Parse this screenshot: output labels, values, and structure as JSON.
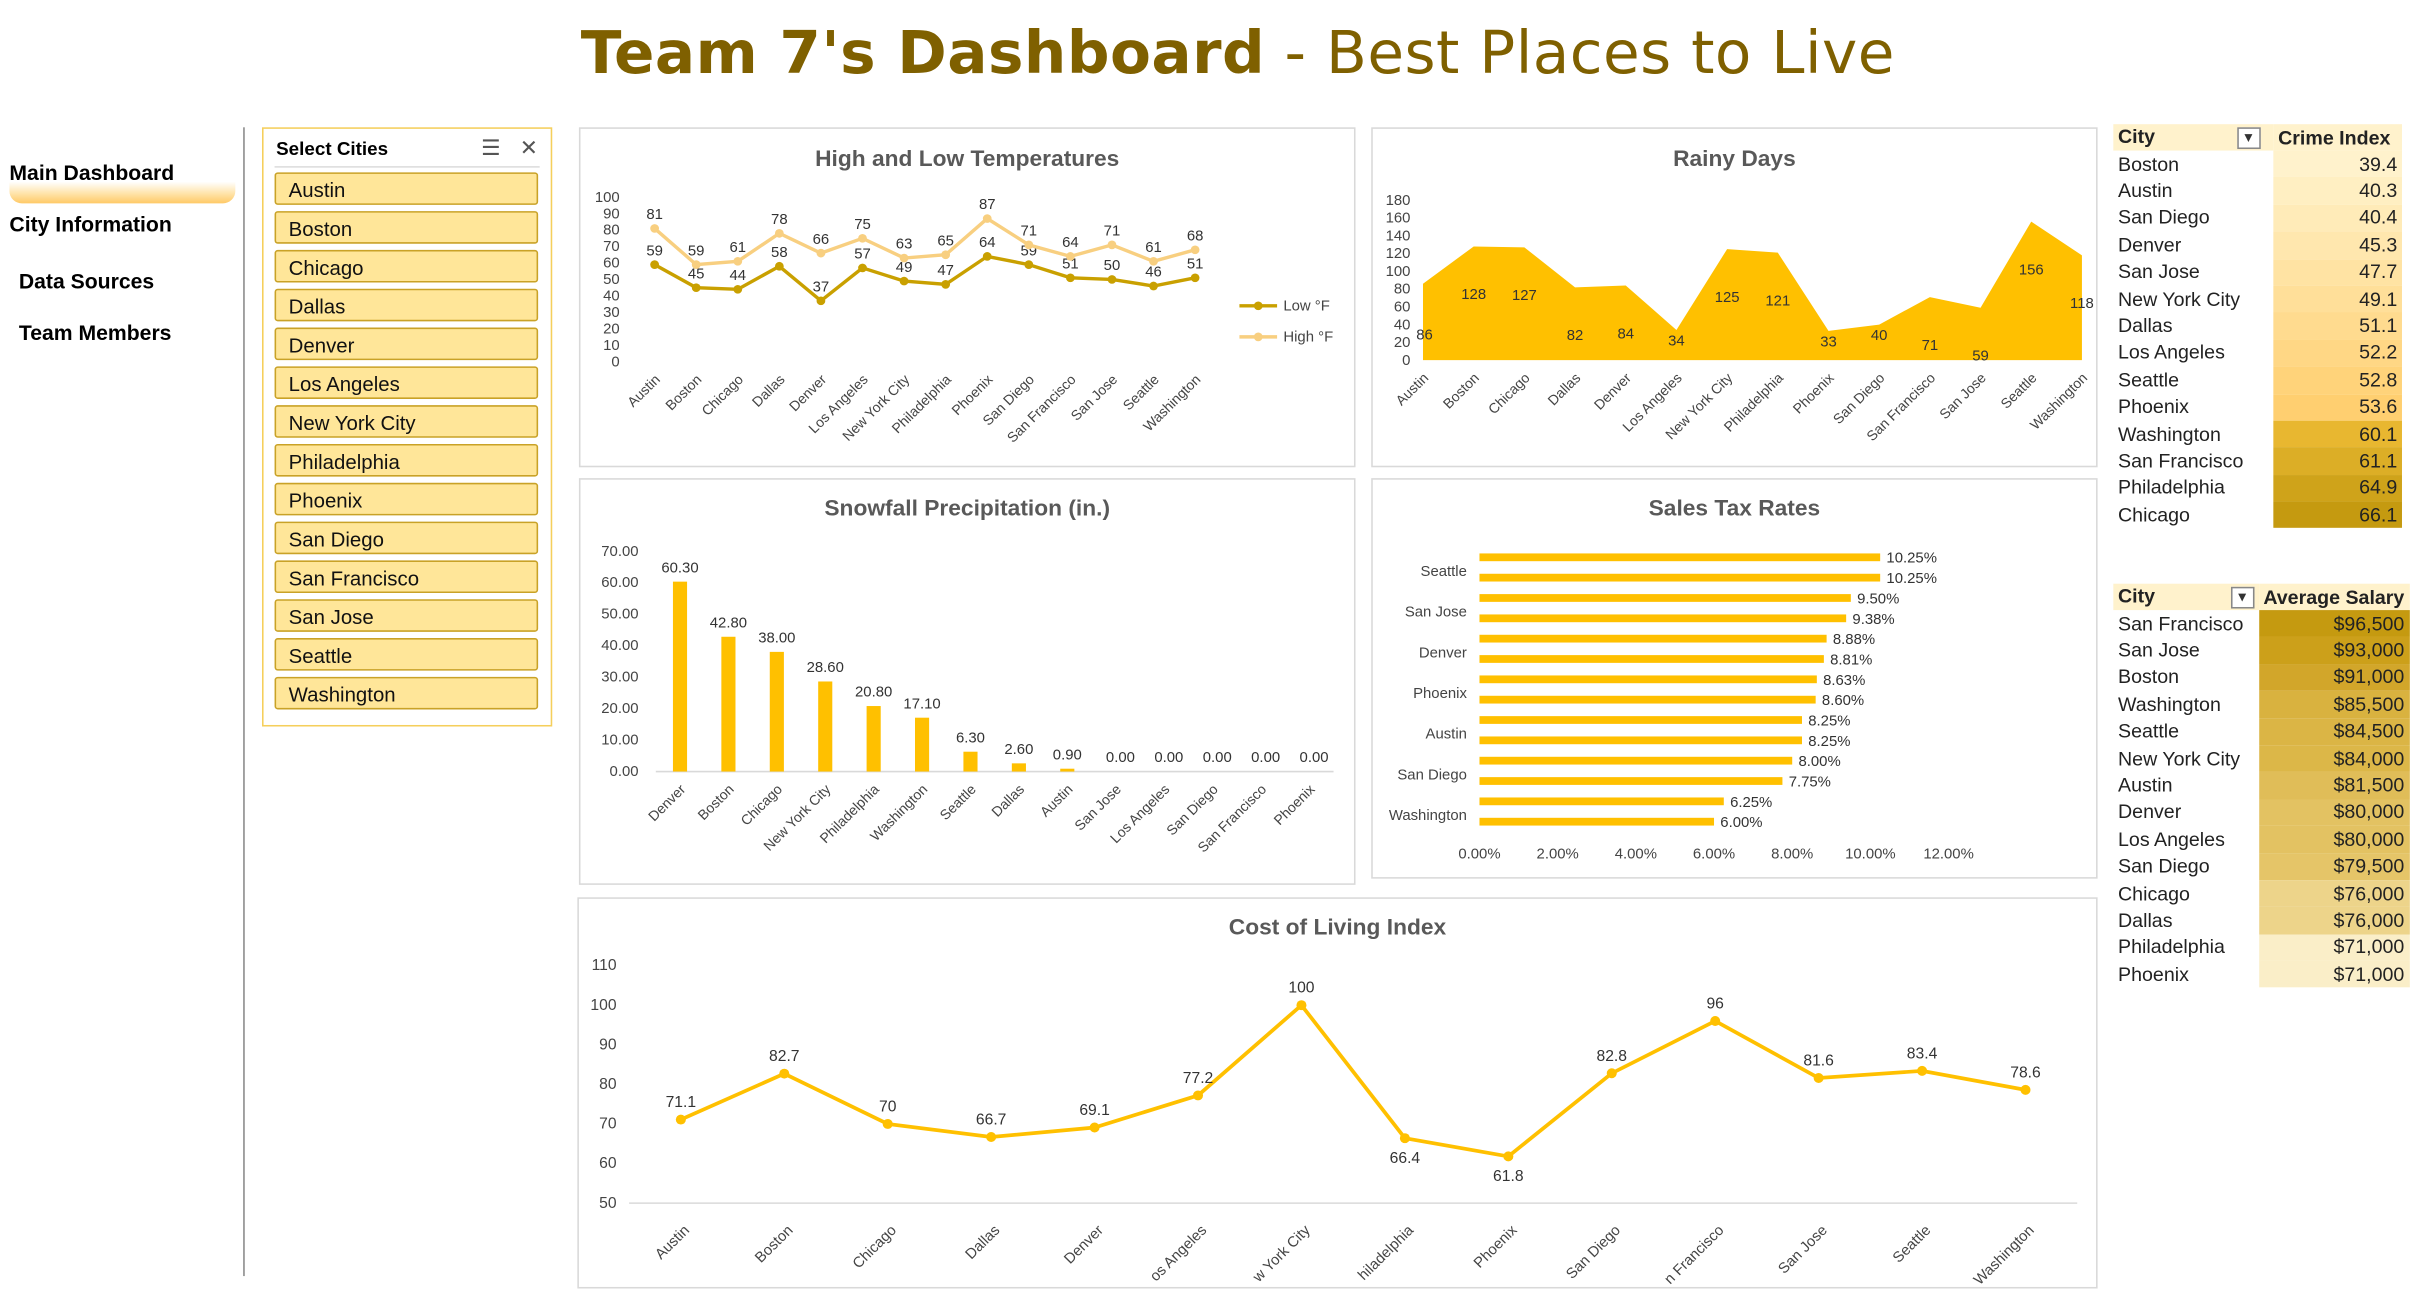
{
  "title": {
    "bold": "Team 7's Dashboard",
    "rest": " - Best Places to Live"
  },
  "nav": [
    {
      "label": "Main Dashboard"
    },
    {
      "label": "City Information"
    },
    {
      "label": "Data Sources"
    },
    {
      "label": "Team Members"
    }
  ],
  "slicer": {
    "title": "Select Cities",
    "icons": [
      "multi-select-icon",
      "clear-filter-icon"
    ],
    "items": [
      "Austin",
      "Boston",
      "Chicago",
      "Dallas",
      "Denver",
      "Los Angeles",
      "New York City",
      "Philadelphia",
      "Phoenix",
      "San Diego",
      "San Francisco",
      "San Jose",
      "Seattle",
      "Washington"
    ]
  },
  "colors": {
    "accent": "#FFC000",
    "dark_gold": "#C9A000",
    "light_gold": "#FFE699",
    "title": "#7F6000",
    "high_line": "#F8CF80"
  },
  "chart_data": [
    {
      "type": "line",
      "title": "High and Low Temperatures",
      "categories": [
        "Austin",
        "Boston",
        "Chicago",
        "Dallas",
        "Denver",
        "Los Angeles",
        "New York City",
        "Philadelphia",
        "Phoenix",
        "San Diego",
        "San Francisco",
        "San Jose",
        "Seattle",
        "Washington"
      ],
      "series": [
        {
          "name": "Low °F",
          "values": [
            59,
            45,
            44,
            58,
            37,
            57,
            49,
            47,
            64,
            59,
            51,
            50,
            46,
            51
          ]
        },
        {
          "name": "High °F",
          "values": [
            81,
            59,
            61,
            78,
            66,
            75,
            63,
            65,
            87,
            71,
            64,
            71,
            61,
            68
          ]
        }
      ],
      "yticks": [
        "0",
        "10",
        "20",
        "30",
        "40",
        "50",
        "60",
        "70",
        "80",
        "90",
        "100"
      ],
      "ylim": [
        0,
        100
      ],
      "legend": "right"
    },
    {
      "type": "area",
      "title": "Rainy Days",
      "categories": [
        "Austin",
        "Boston",
        "Chicago",
        "Dallas",
        "Denver",
        "Los Angeles",
        "New York City",
        "Philadelphia",
        "Phoenix",
        "San Diego",
        "San Francisco",
        "San Jose",
        "Seattle",
        "Washington"
      ],
      "values": [
        86,
        128,
        127,
        82,
        84,
        34,
        125,
        121,
        33,
        40,
        71,
        59,
        156,
        118
      ],
      "yticks": [
        "0",
        "20",
        "40",
        "60",
        "80",
        "100",
        "120",
        "140",
        "160",
        "180"
      ],
      "ylim": [
        0,
        180
      ]
    },
    {
      "type": "bar",
      "title": "Snowfall Precipitation (in.)",
      "categories": [
        "Denver",
        "Boston",
        "Chicago",
        "New York City",
        "Philadelphia",
        "Washington",
        "Seattle",
        "Dallas",
        "Austin",
        "San Jose",
        "Los Angeles",
        "San Diego",
        "San Francisco",
        "Phoenix"
      ],
      "values": [
        60.3,
        42.8,
        38.0,
        28.6,
        20.8,
        17.1,
        6.3,
        2.6,
        0.9,
        0,
        0,
        0,
        0,
        0
      ],
      "labels": [
        "60.30",
        "42.80",
        "38.00",
        "28.60",
        "20.80",
        "17.10",
        "6.30",
        "2.60",
        "0.90",
        "0.00",
        "0.00",
        "0.00",
        "0.00",
        "0.00"
      ],
      "yticks": [
        "0.00",
        "10.00",
        "20.00",
        "30.00",
        "40.00",
        "50.00",
        "60.00",
        "70.00"
      ],
      "ylim": [
        0,
        70
      ]
    },
    {
      "type": "bar",
      "orientation": "horizontal",
      "title": "Sales Tax Rates",
      "values": [
        10.25,
        10.25,
        9.5,
        9.38,
        8.88,
        8.81,
        8.63,
        8.6,
        8.25,
        8.25,
        8.0,
        7.75,
        6.25,
        6.0
      ],
      "labels": [
        "10.25%",
        "10.25%",
        "9.50%",
        "9.38%",
        "8.88%",
        "8.81%",
        "8.63%",
        "8.60%",
        "8.25%",
        "8.25%",
        "8.00%",
        "7.75%",
        "6.25%",
        "6.00%"
      ],
      "shown_categories": [
        "Seattle",
        "San Jose",
        "Denver",
        "Phoenix",
        "Austin",
        "San Diego",
        "Washington"
      ],
      "xticks": [
        "0.00%",
        "2.00%",
        "4.00%",
        "6.00%",
        "8.00%",
        "10.00%",
        "12.00%"
      ],
      "xlim": [
        0,
        12
      ]
    },
    {
      "type": "line",
      "title": "Cost of Living Index",
      "categories": [
        "Austin",
        "Boston",
        "Chicago",
        "Dallas",
        "Denver",
        "Los Angeles",
        "New York City",
        "Philadelphia",
        "Phoenix",
        "San Diego",
        "San Francisco",
        "San Jose",
        "Seattle",
        "Washington"
      ],
      "shown_tick_labels": [
        "Austin",
        "Boston",
        "Chicago",
        "Dallas",
        "Denver",
        "os Angeles",
        "w York City",
        "hiladelphia",
        "Phoenix",
        "San Diego",
        "n Francisco",
        "San Jose",
        "Seattle",
        "Washington"
      ],
      "values": [
        71.1,
        82.7,
        70,
        66.7,
        69.1,
        77.2,
        100,
        66.4,
        61.8,
        82.8,
        96,
        81.6,
        83.4,
        78.6
      ],
      "labels": [
        "71.1",
        "82.7",
        "70",
        "66.7",
        "69.1",
        "77.2",
        "100",
        "66.4",
        "61.8",
        "82.8",
        "96",
        "81.6",
        "83.4",
        "78.6"
      ],
      "yticks": [
        "50",
        "60",
        "70",
        "80",
        "90",
        "100",
        "110"
      ],
      "ylim": [
        50,
        110
      ]
    }
  ],
  "crime_table": {
    "headers": [
      "City",
      "Crime Index"
    ],
    "rows": [
      [
        "Boston",
        "39.4"
      ],
      [
        "Austin",
        "40.3"
      ],
      [
        "San Diego",
        "40.4"
      ],
      [
        "Denver",
        "45.3"
      ],
      [
        "San Jose",
        "47.7"
      ],
      [
        "New York City",
        "49.1"
      ],
      [
        "Dallas",
        "51.1"
      ],
      [
        "Los Angeles",
        "52.2"
      ],
      [
        "Seattle",
        "52.8"
      ],
      [
        "Phoenix",
        "53.6"
      ],
      [
        "Washington",
        "60.1"
      ],
      [
        "San Francisco",
        "61.1"
      ],
      [
        "Philadelphia",
        "64.9"
      ],
      [
        "Chicago",
        "66.1"
      ]
    ],
    "shades": [
      "#FFF2CC",
      "#FFEFC2",
      "#FFEBB8",
      "#FFE7AE",
      "#FFE3A3",
      "#FFDF99",
      "#FFDB8F",
      "#FFD785",
      "#FFD37A",
      "#FFCF70",
      "#E8B730",
      "#DCAE26",
      "#CFA31A",
      "#C59A10"
    ]
  },
  "salary_table": {
    "headers": [
      "City",
      "Average Salary"
    ],
    "rows": [
      [
        "San Francisco",
        "$96,500"
      ],
      [
        "San Jose",
        "$93,000"
      ],
      [
        "Boston",
        "$91,000"
      ],
      [
        "Washington",
        "$85,500"
      ],
      [
        "Seattle",
        "$84,500"
      ],
      [
        "New York City",
        "$84,000"
      ],
      [
        "Austin",
        "$81,500"
      ],
      [
        "Denver",
        "$80,000"
      ],
      [
        "Los Angeles",
        "$80,000"
      ],
      [
        "San Diego",
        "$79,500"
      ],
      [
        "Chicago",
        "$76,000"
      ],
      [
        "Dallas",
        "$76,000"
      ],
      [
        "Philadelphia",
        "$71,000"
      ],
      [
        "Phoenix",
        "$71,000"
      ]
    ],
    "shades": [
      "#C59A10",
      "#CCA01A",
      "#D2A62A",
      "#D9B23F",
      "#DBB545",
      "#DCB748",
      "#E0BD58",
      "#E3C262",
      "#E3C262",
      "#E5C568",
      "#EDD48A",
      "#EDD48A",
      "#FAEEC8",
      "#FAEEC8"
    ]
  }
}
